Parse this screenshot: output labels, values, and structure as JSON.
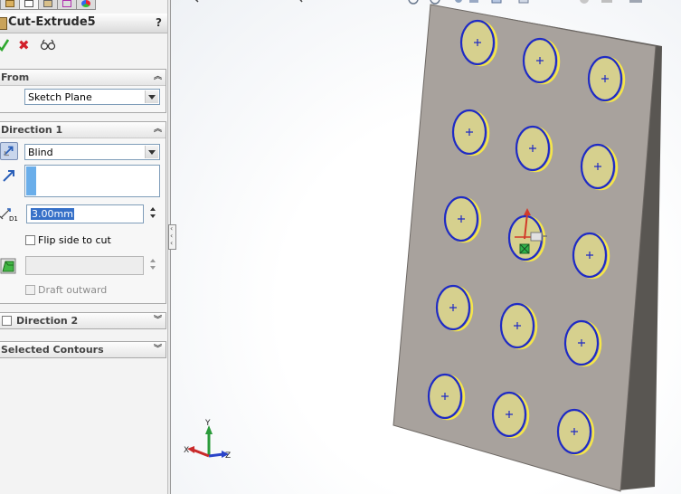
{
  "feature": {
    "title": "Cut-Extrude5",
    "help": "?",
    "tabs": [
      "feature-manager-icon",
      "property-manager-icon",
      "configuration-manager-icon",
      "dimxpert-manager-icon",
      "display-manager-icon"
    ]
  },
  "actions": {
    "ok": "ok-checkmark",
    "cancel": "✖",
    "preview": "detailed-preview"
  },
  "from": {
    "header": "From",
    "start_condition": "Sketch Plane"
  },
  "direction1": {
    "header": "Direction 1",
    "end_condition": "Blind",
    "depth": "3.00mm",
    "depth_icon_label": "D1",
    "flip_side_label": "Flip side to cut",
    "draft_outward_label": "Draft outward",
    "draft_angle": ""
  },
  "direction2": {
    "header": "Direction 2"
  },
  "selected_contours": {
    "header": "Selected Contours"
  },
  "triad": {
    "x": "X",
    "y": "Y",
    "z": "Z"
  },
  "colors": {
    "plate_face": "#a8a29d",
    "plate_edge": "#595652",
    "hole_fill": "#d6d08e",
    "hole_outline": "#1f2bc4",
    "hole_highlight": "#f5e64a",
    "panel_bg": "#f3f3f3"
  }
}
